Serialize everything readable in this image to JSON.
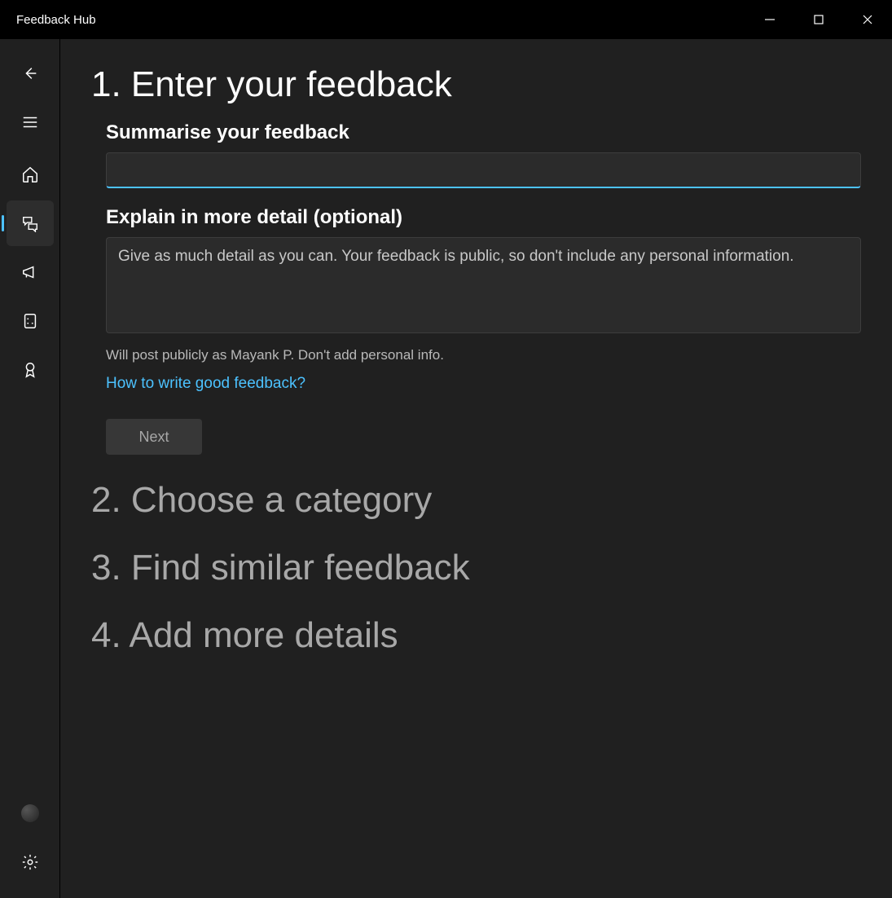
{
  "titlebar": {
    "title": "Feedback Hub"
  },
  "sidebar": {
    "back": "back",
    "menu": "menu",
    "items": [
      "home",
      "feedback",
      "announcements",
      "quests",
      "achievements"
    ],
    "activeIndex": 1,
    "profile": "profile",
    "settings": "settings"
  },
  "steps": {
    "s1": "1. Enter your feedback",
    "s2": "2. Choose a category",
    "s3": "3. Find similar feedback",
    "s4": "4. Add more details"
  },
  "form": {
    "summaryLabel": "Summarise your feedback",
    "summaryValue": "",
    "detailLabel": "Explain in more detail (optional)",
    "detailPlaceholder": "Give as much detail as you can. Your feedback is public, so don't include any personal information.",
    "detailValue": "",
    "caption": "Will post publicly as Mayank P. Don't add personal info.",
    "helpLink": "How to write good feedback?",
    "nextLabel": "Next"
  }
}
